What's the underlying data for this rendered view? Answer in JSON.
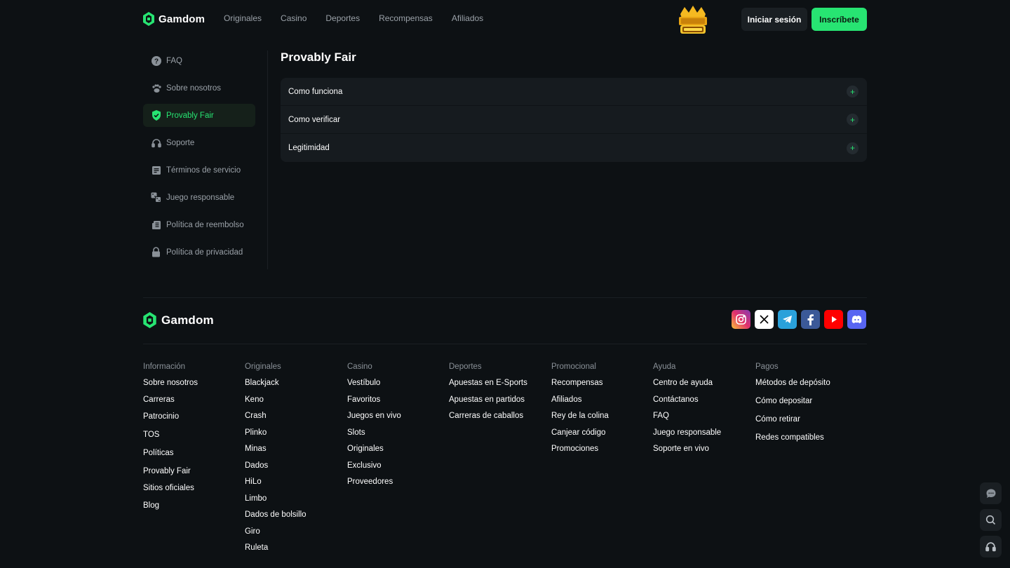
{
  "header": {
    "brand": "Gamdom",
    "nav": [
      "Originales",
      "Casino",
      "Deportes",
      "Recompensas",
      "Afiliados"
    ],
    "promo_banner_icon": "king-of-the-hill-500k",
    "login_label": "Iniciar sesión",
    "signup_label": "Inscríbete",
    "accent_color": "#27e472"
  },
  "sidebar": {
    "items": [
      {
        "label": "FAQ",
        "icon": "question-icon",
        "active": false
      },
      {
        "label": "Sobre nosotros",
        "icon": "paw-icon",
        "active": false
      },
      {
        "label": "Provably Fair",
        "icon": "shield-check-icon",
        "active": true
      },
      {
        "label": "Soporte",
        "icon": "headset-icon",
        "active": false
      },
      {
        "label": "Términos de servicio",
        "icon": "document-icon",
        "active": false
      },
      {
        "label": "Juego responsable",
        "icon": "dice-icon",
        "active": false
      },
      {
        "label": "Política de reembolso",
        "icon": "receipt-icon",
        "active": false
      },
      {
        "label": "Política de privacidad",
        "icon": "lock-icon",
        "active": false
      }
    ]
  },
  "main": {
    "title": "Provably Fair",
    "accordion": [
      {
        "label": "Como funciona"
      },
      {
        "label": "Como verificar"
      },
      {
        "label": "Legitimidad"
      }
    ]
  },
  "footer": {
    "brand": "Gamdom",
    "socials": [
      "instagram-icon",
      "x-icon",
      "telegram-icon",
      "facebook-icon",
      "youtube-icon",
      "discord-icon"
    ],
    "columns": [
      {
        "title": "Información",
        "links": [
          "Sobre nosotros",
          "Carreras",
          "Patrocinio",
          "TOS",
          "Políticas",
          "Provably Fair",
          "Sitios oficiales",
          "Blog"
        ]
      },
      {
        "title": "Originales",
        "links": [
          "Blackjack",
          "Keno",
          "Crash",
          "Plinko",
          "Minas",
          "Dados",
          "HiLo",
          "Limbo",
          "Dados de bolsillo",
          "Giro",
          "Ruleta"
        ]
      },
      {
        "title": "Casino",
        "links": [
          "Vestíbulo",
          "Favoritos",
          "Juegos en vivo",
          "Slots",
          "Originales",
          "Exclusivo",
          "Proveedores"
        ]
      },
      {
        "title": "Deportes",
        "links": [
          "Apuestas en E-Sports",
          "Apuestas en partidos",
          "Carreras de caballos"
        ]
      },
      {
        "title": "Promocional",
        "links": [
          "Recompensas",
          "Afiliados",
          "Rey de la colina",
          "Canjear código",
          "Promociones"
        ]
      },
      {
        "title": "Ayuda",
        "links": [
          "Centro de ayuda",
          "Contáctanos",
          "FAQ",
          "Juego responsable",
          "Soporte en vivo"
        ]
      },
      {
        "title": "Pagos",
        "links": [
          "Métodos de depósito",
          "Cómo depositar",
          "Cómo retirar",
          "Redes compatibles"
        ]
      }
    ]
  },
  "floating": [
    "chat-icon",
    "search-icon",
    "support-headset-icon"
  ]
}
